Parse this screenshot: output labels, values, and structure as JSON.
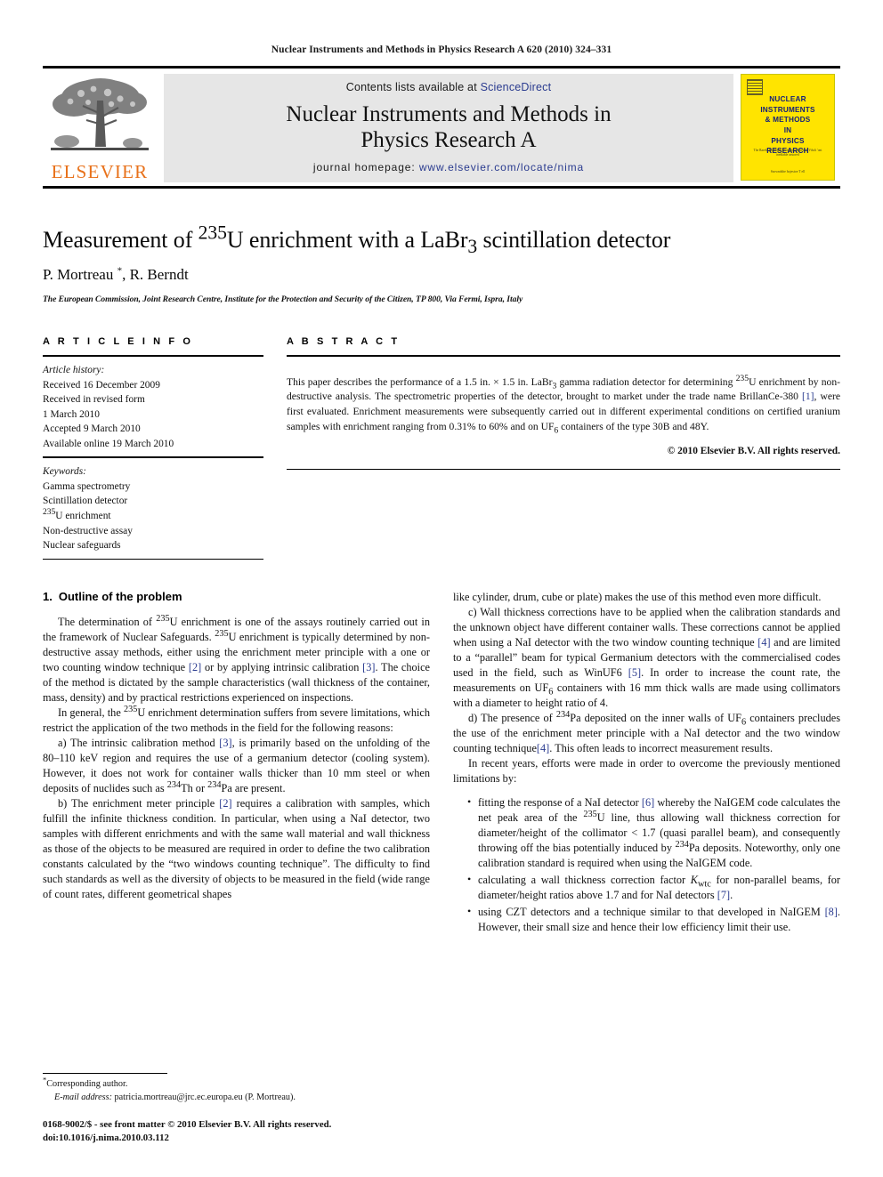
{
  "running_head": "Nuclear Instruments and Methods in Physics Research A 620 (2010) 324–331",
  "masthead": {
    "publisher_wordmark": "ELSEVIER",
    "contents_prefix": "Contents lists available at",
    "contents_link": "ScienceDirect",
    "journal_title_line1": "Nuclear Instruments and Methods in",
    "journal_title_line2": "Physics Research A",
    "homepage_prefix": "journal homepage:",
    "homepage_url": "www.elsevier.com/locate/nima",
    "cover": {
      "title_lines": [
        "NUCLEAR",
        "INSTRUMENTS",
        "& METHODS",
        "IN",
        "PHYSICS",
        "RESEARCH"
      ],
      "subtitle": "The Rarek, Acadlinei' lewispecto rimence, Vihcli 'ont inediable asstored",
      "footer": "Ssowndshe hojestoe T ell",
      "background_color": "#FFE400",
      "title_color": "#15207a"
    },
    "link_color": "#2a3b8f",
    "elsevier_color": "#E8711A"
  },
  "article": {
    "title_prefix": "Measurement of ",
    "title_sup1": "235",
    "title_mid": "U enrichment with a LaBr",
    "title_sub1": "3",
    "title_suffix": " scintillation detector",
    "authors_part1": "P. Mortreau ",
    "authors_star": "*",
    "authors_part2": ", R. Berndt",
    "affiliation": "The European Commission, Joint Research Centre, Institute for the Protection and Security of the Citizen, TP 800, Via Fermi, Ispra, Italy"
  },
  "article_info": {
    "heading": "A R T I C L E   I N F O",
    "history_label": "Article history:",
    "history": [
      "Received 16 December 2009",
      "Received in revised form",
      "1 March 2010",
      "Accepted 9 March 2010",
      "Available online 19 March 2010"
    ],
    "keywords_label": "Keywords:",
    "keywords_plain": [
      "Gamma spectrometry",
      "Scintillation detector"
    ],
    "keyword_sup": "235",
    "keyword_sup_rest": "U enrichment",
    "keywords_plain2": [
      "Non-destructive assay",
      "Nuclear safeguards"
    ]
  },
  "abstract": {
    "heading": "A B S T R A C T",
    "part1": "This paper describes the performance of a 1.5 in. × 1.5 in. LaBr",
    "sub1": "3",
    "part2": " gamma radiation detector for determining ",
    "sup1": "235",
    "part3": "U enrichment by non-destructive analysis. The spectrometric properties of the detector, brought to market under the trade name BrillanCe-380 ",
    "ref1": "[1]",
    "part4": ", were first evaluated. Enrichment measurements were subsequently carried out in different experimental conditions on certified uranium samples with enrichment ranging from 0.31% to 60% and on UF",
    "sub2": "6",
    "part5": " containers of the type 30B and 48Y.",
    "copyright": "© 2010 Elsevier B.V. All rights reserved."
  },
  "section1": {
    "number": "1.",
    "title": "Outline of the problem"
  },
  "left_column": {
    "p1_a": "The determination of ",
    "p1_sup1": "235",
    "p1_b": "U enrichment is one of the assays routinely carried out in the framework of Nuclear Safeguards. ",
    "p1_sup2": "235",
    "p1_c": "U enrichment is typically determined by non-destructive assay methods, either using the enrichment meter principle with a one or two counting window technique ",
    "p1_ref2": "[2]",
    "p1_d": " or by applying intrinsic calibration ",
    "p1_ref3": "[3]",
    "p1_e": ". The choice of the method is dictated by the sample characteristics (wall thickness of the container, mass, density) and by practical restrictions experienced on inspections.",
    "p2_a": "In general, the ",
    "p2_sup1": "235",
    "p2_b": "U enrichment determination suffers from severe limitations, which restrict the application of the two methods in the field for the following reasons:",
    "p3_a": "a) The intrinsic calibration method ",
    "p3_ref3": "[3]",
    "p3_b": ", is primarily based on the unfolding of the 80–110 keV region and requires the use of a germanium detector (cooling system). However, it does not work for container walls thicker than 10 mm steel or when deposits of nuclides such as ",
    "p3_sup1": "234",
    "p3_c": "Th or ",
    "p3_sup2": "234",
    "p3_d": "Pa are present.",
    "p4_a": "b) The enrichment meter principle ",
    "p4_ref2": "[2]",
    "p4_b": " requires a calibration with samples, which fulfill the infinite thickness condition. In particular, when using a NaI detector, two samples with different enrichments and with the same wall material and wall thickness as those of the objects to be measured are required in order to define the two calibration constants calculated by the “two windows counting technique”. The difficulty to find such standards as well as the diversity of objects to be measured in the field (wide range of count rates, different geometrical shapes"
  },
  "right_column": {
    "p5": "like cylinder, drum, cube or plate) makes the use of this method even more difficult.",
    "p6_a": "c) Wall thickness corrections have to be applied when the calibration standards and the unknown object have different container walls. These corrections cannot be applied when using a NaI detector with the two window counting technique ",
    "p6_ref4": "[4]",
    "p6_b": " and are limited to a “parallel” beam for typical Germanium detectors with the commercialised codes used in the field, such as WinUF6 ",
    "p6_ref5": "[5]",
    "p6_c": ". In order to increase the count rate, the measurements on UF",
    "p6_sub6": "6",
    "p6_d": " containers with 16 mm thick walls are made using collimators with a diameter to height ratio of 4.",
    "p7_a": "d) The presence of ",
    "p7_sup1": "234",
    "p7_b": "Pa deposited on the inner walls of UF",
    "p7_sub6": "6",
    "p7_c": " containers precludes the use of the enrichment meter principle with a NaI detector and the two window counting technique",
    "p7_ref4": "[4]",
    "p7_d": ". This often leads to incorrect measurement results.",
    "p8": "In recent years, efforts were made in order to overcome the previously mentioned limitations by:",
    "b1_a": "fitting the response of a NaI detector ",
    "b1_ref6": "[6]",
    "b1_b": " whereby the NaIGEM code calculates the net peak area of the ",
    "b1_sup1": "235",
    "b1_c": "U line, thus allowing wall thickness correction for diameter/height of the collimator < 1.7 (quasi parallel beam), and consequently throwing off the bias potentially induced by ",
    "b1_sup2": "234",
    "b1_d": "Pa deposits. Noteworthy, only one calibration standard is required when using the NaIGEM code.",
    "b2_a": "calculating a wall thickness correction factor ",
    "b2_k": "K",
    "b2_ksub": "wtc",
    "b2_b": " for non-parallel beams, for diameter/height ratios above 1.7 and for NaI detectors ",
    "b2_ref7": "[7]",
    "b2_c": ".",
    "b3_a": "using CZT detectors and a technique similar to that developed in NaIGEM ",
    "b3_ref8": "[8]",
    "b3_b": ". However, their small size and hence their low efficiency limit their use."
  },
  "footnote": {
    "star": "*",
    "corresponding": "Corresponding author.",
    "email_label": "E-mail address:",
    "email_value": " patricia.mortreau@jrc.ec.europa.eu (P. Mortreau).",
    "issn_line1": "0168-9002/$ - see front matter © 2010 Elsevier B.V. All rights reserved.",
    "issn_line2": "doi:10.1016/j.nima.2010.03.112"
  }
}
